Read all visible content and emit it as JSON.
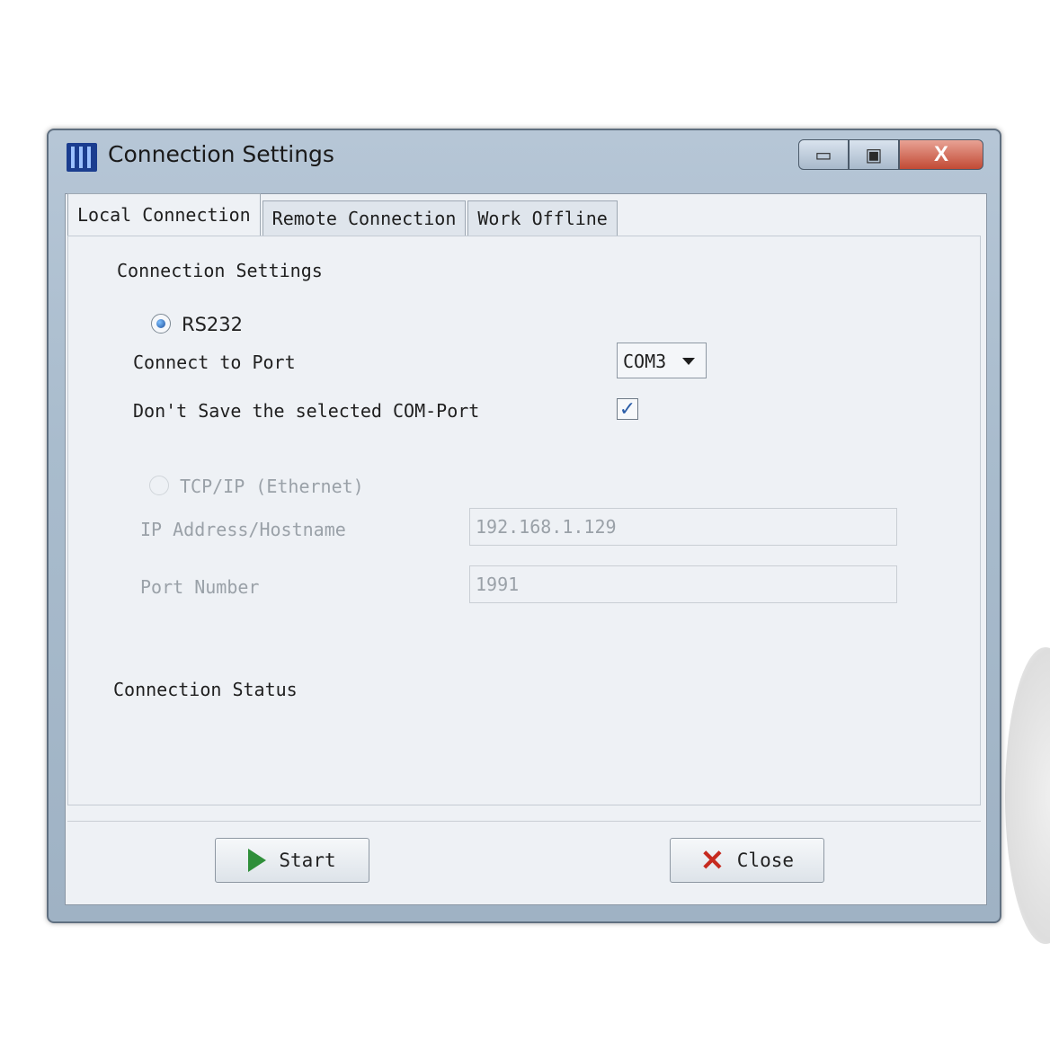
{
  "window": {
    "title": "Connection Settings",
    "controls": {
      "minimize": "▭",
      "maximize": "▣",
      "close": "X"
    }
  },
  "tabs": [
    {
      "label": "Local Connection",
      "active": true
    },
    {
      "label": "Remote Connection",
      "active": false
    },
    {
      "label": "Work Offline",
      "active": false
    }
  ],
  "local": {
    "section_title": "Connection Settings",
    "rs232_label": "RS232",
    "connect_port_label": "Connect to Port",
    "port_value": "COM3",
    "dont_save_label": "Don't Save the selected COM-Port",
    "dont_save_checked_glyph": "✓",
    "tcpip_label": "TCP/IP (Ethernet)",
    "ip_label": "IP Address/Hostname",
    "ip_value": "192.168.1.129",
    "port_number_label": "Port Number",
    "port_number_value": "1991",
    "status_label": "Connection Status"
  },
  "buttons": {
    "start": "Start",
    "close": "Close"
  },
  "colors": {
    "accent": "#2f8f3a",
    "danger": "#c62a1f"
  }
}
